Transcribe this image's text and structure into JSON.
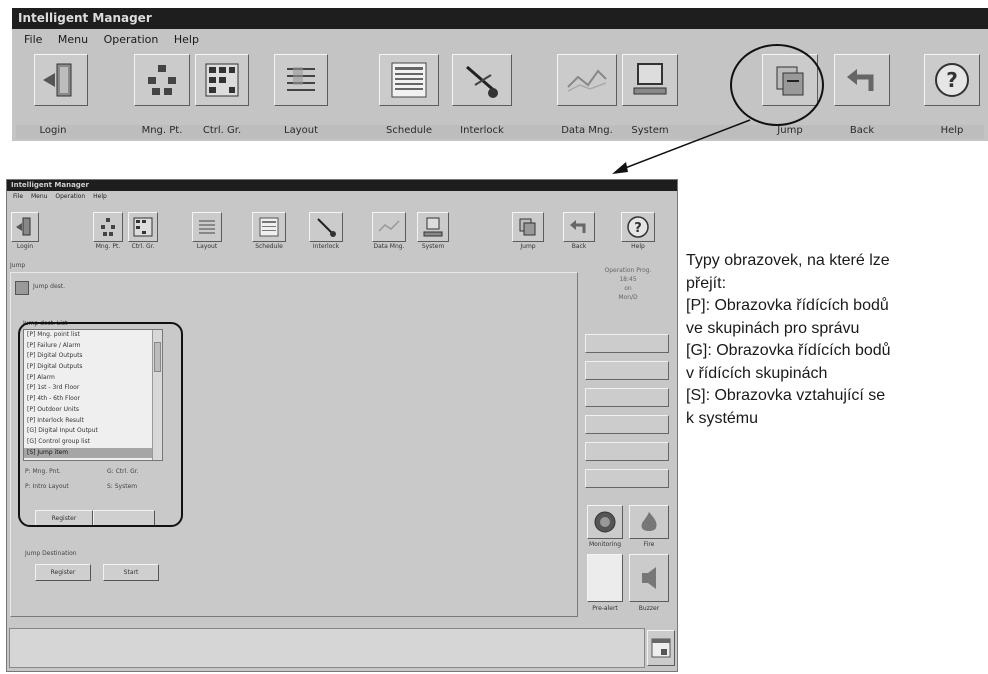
{
  "big_window": {
    "title": "Intelligent Manager",
    "menu": [
      "File",
      "Menu",
      "Operation",
      "Help"
    ],
    "toolbar": [
      {
        "label": "Login",
        "icon": "door-icon"
      },
      {
        "label": "Mng. Pt.",
        "icon": "points-icon"
      },
      {
        "label": "Ctrl. Gr.",
        "icon": "control-group-icon"
      },
      {
        "label": "Layout",
        "icon": "layout-icon"
      },
      {
        "label": "Schedule",
        "icon": "calendar-icon"
      },
      {
        "label": "Interlock",
        "icon": "interlock-icon"
      },
      {
        "label": "Data Mng.",
        "icon": "chart-icon"
      },
      {
        "label": "System",
        "icon": "computer-icon"
      },
      {
        "label": "Jump",
        "icon": "jump-icon"
      },
      {
        "label": "Back",
        "icon": "back-arrow-icon"
      },
      {
        "label": "Help",
        "icon": "help-icon"
      }
    ]
  },
  "small_window": {
    "title": "Intelligent Manager",
    "menu": [
      "File",
      "Menu",
      "Operation",
      "Help"
    ],
    "toolbar": [
      {
        "label": "Login"
      },
      {
        "label": "Mng. Pt."
      },
      {
        "label": "Ctrl. Gr."
      },
      {
        "label": "Layout"
      },
      {
        "label": "Schedule"
      },
      {
        "label": "Interlock"
      },
      {
        "label": "Data Mng."
      },
      {
        "label": "System"
      },
      {
        "label": "Jump"
      },
      {
        "label": "Back"
      },
      {
        "label": "Help"
      }
    ],
    "section_label": "Jump",
    "tree_label": "Jump dest.",
    "list_header": "Jump dest. List",
    "list_items": [
      "[P] Mng. point list",
      "[P] Failure / Alarm",
      "[P] Digital Outputs",
      "[P] Digital Outputs",
      "[P] Alarm",
      "[P] 1st - 3rd Floor",
      "[P] 4th - 6th Floor",
      "[P] Outdoor Units",
      "[P] Interlock Result",
      "[G] Digital Input Output",
      "[G] Control group list",
      "[S] Jump item"
    ],
    "legend_left_1": "P: Mng. Pnt.",
    "legend_right_1": "G: Ctrl. Gr.",
    "legend_left_2": "P: Intro Layout",
    "legend_right_2": "S: System",
    "register_label": "Register",
    "delete_label": "",
    "other_label": "Jump Destination",
    "register2_label": "Register",
    "start_label": "Start",
    "status_right": [
      "Operation Prog.",
      "18:45",
      "on",
      "Mon/D"
    ],
    "round_labels": [
      "Monitoring",
      "Fire"
    ],
    "bottom_labels": [
      "Pre-alert",
      "Buzzer"
    ]
  },
  "description": {
    "lines": [
      "Typy obrazovek, na které lze",
      "přejít:",
      "[P]: Obrazovka řídících bodů",
      "ve skupinách pro správu",
      "[G]: Obrazovka řídících bodů",
      "v řídících skupinách",
      "[S]: Obrazovka vztahující se",
      "k systému"
    ]
  }
}
